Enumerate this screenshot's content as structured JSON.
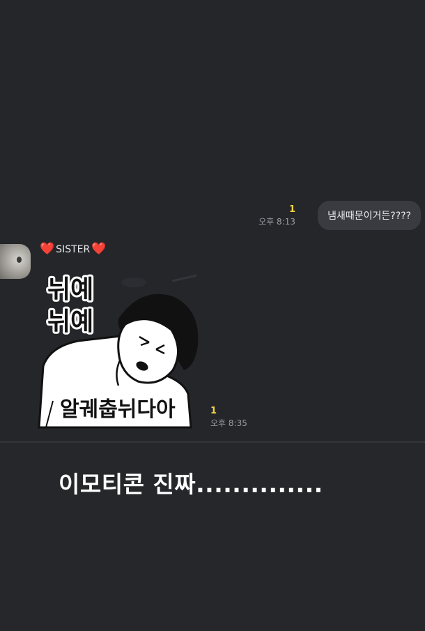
{
  "outgoing": {
    "unread_count": "1",
    "time": "오후 8:13",
    "text": "냄새때문이거든????"
  },
  "incoming": {
    "sender_name": "SISTER",
    "heart_icon": "❤️",
    "unread_count": "1",
    "time": "오후 8:35",
    "sticker": {
      "text_top_line1": "뉘예",
      "text_top_line2": "뉘예",
      "text_bottom": "알궤춥뉘다아"
    }
  },
  "caption": "이모티콘 진짜..............",
  "colors": {
    "background": "#25262a",
    "bubble": "#3a3b41",
    "unread": "#f2d546",
    "heart": "#e0262d"
  }
}
